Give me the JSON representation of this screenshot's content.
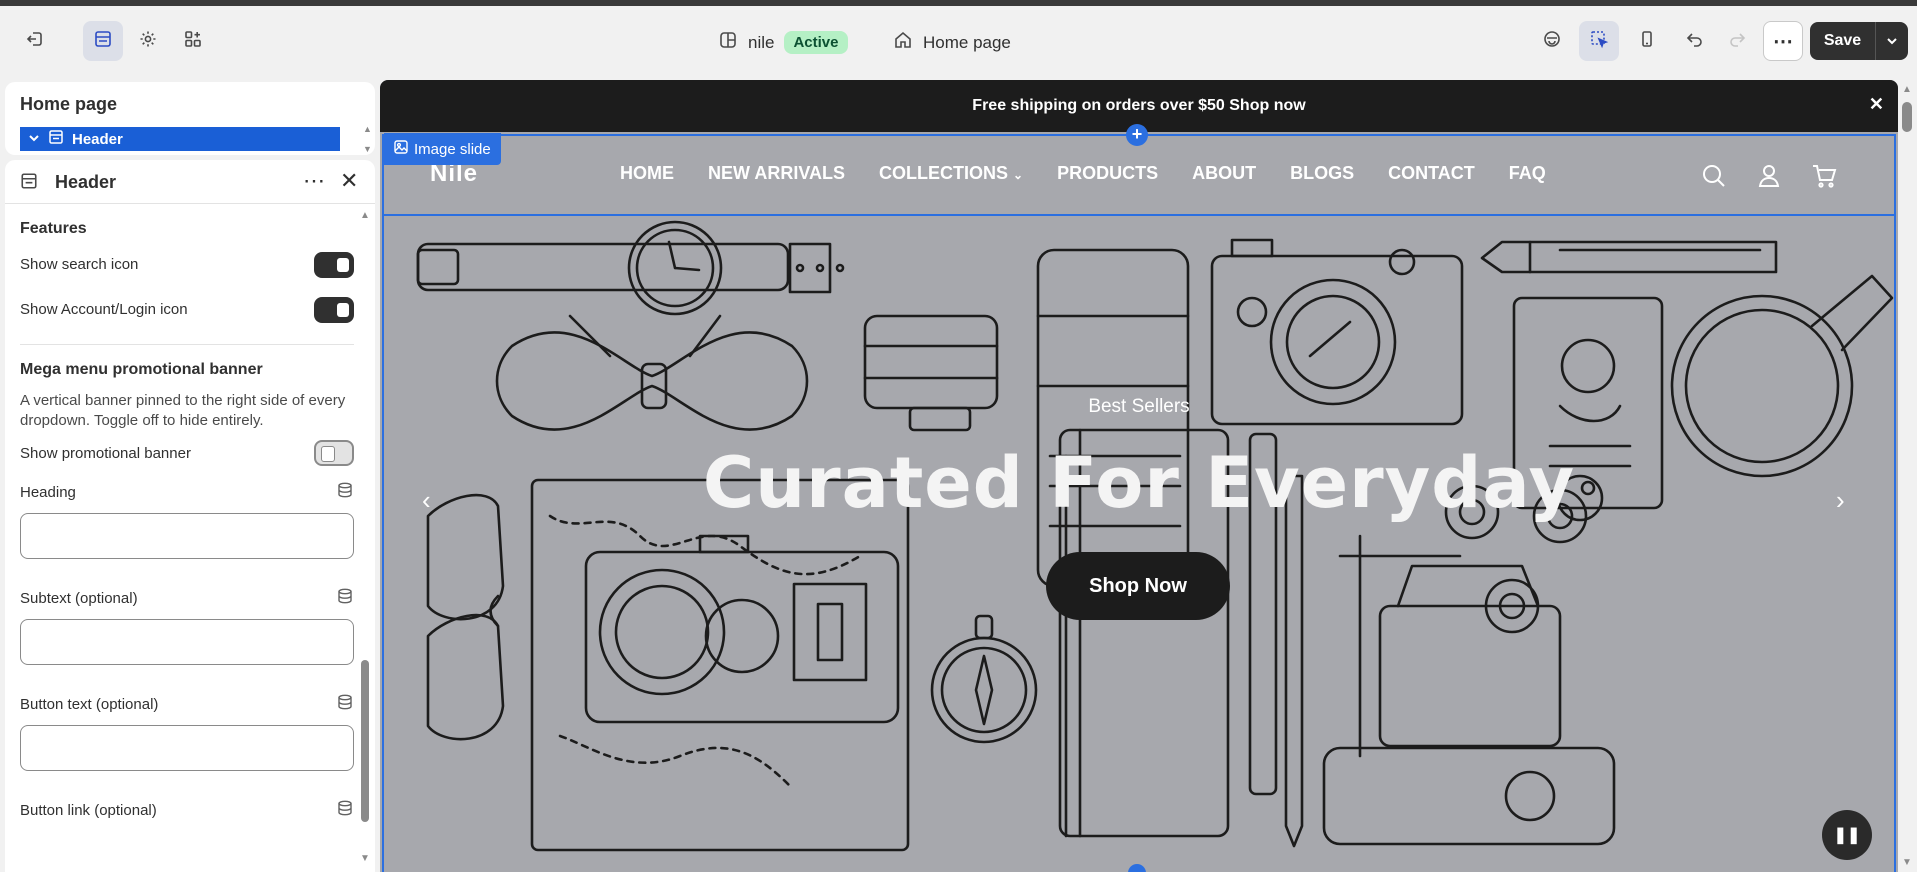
{
  "topbar": {
    "store_name": "nile",
    "status_badge": "Active",
    "page_name": "Home page",
    "save_label": "Save"
  },
  "outline": {
    "title": "Home page",
    "selected_item": "Header"
  },
  "settings": {
    "title": "Header",
    "features_title": "Features",
    "show_search_label": "Show search icon",
    "show_search_on": true,
    "show_account_label": "Show Account/Login icon",
    "show_account_on": true,
    "mega_title": "Mega menu promotional banner",
    "mega_desc": "A vertical banner pinned to the right side of every dropdown. Toggle off to hide entirely.",
    "show_promo_label": "Show promotional banner",
    "show_promo_on": false,
    "heading_label": "Heading",
    "heading_value": "",
    "subtext_label": "Subtext (optional)",
    "subtext_value": "",
    "button_text_label": "Button text (optional)",
    "button_text_value": "",
    "button_link_label": "Button link (optional)"
  },
  "preview": {
    "announcement": "Free shipping on orders over $50 Shop now",
    "section_tag": "Image slide",
    "logo": "Nile",
    "nav": [
      "HOME",
      "NEW ARRIVALS",
      "COLLECTIONS",
      "PRODUCTS",
      "ABOUT",
      "BLOGS",
      "CONTACT",
      "FAQ"
    ],
    "slide_kicker": "Best Sellers",
    "slide_heading": "Curated For Everyday",
    "slide_button": "Shop Now",
    "prev_arrow": "‹",
    "next_arrow": "›"
  },
  "colors": {
    "accent_blue": "#2b6fe0",
    "selected_blue": "#1a5fd6",
    "hero_bg": "#a7a8ad",
    "badge_green": "#b5f0c5"
  }
}
